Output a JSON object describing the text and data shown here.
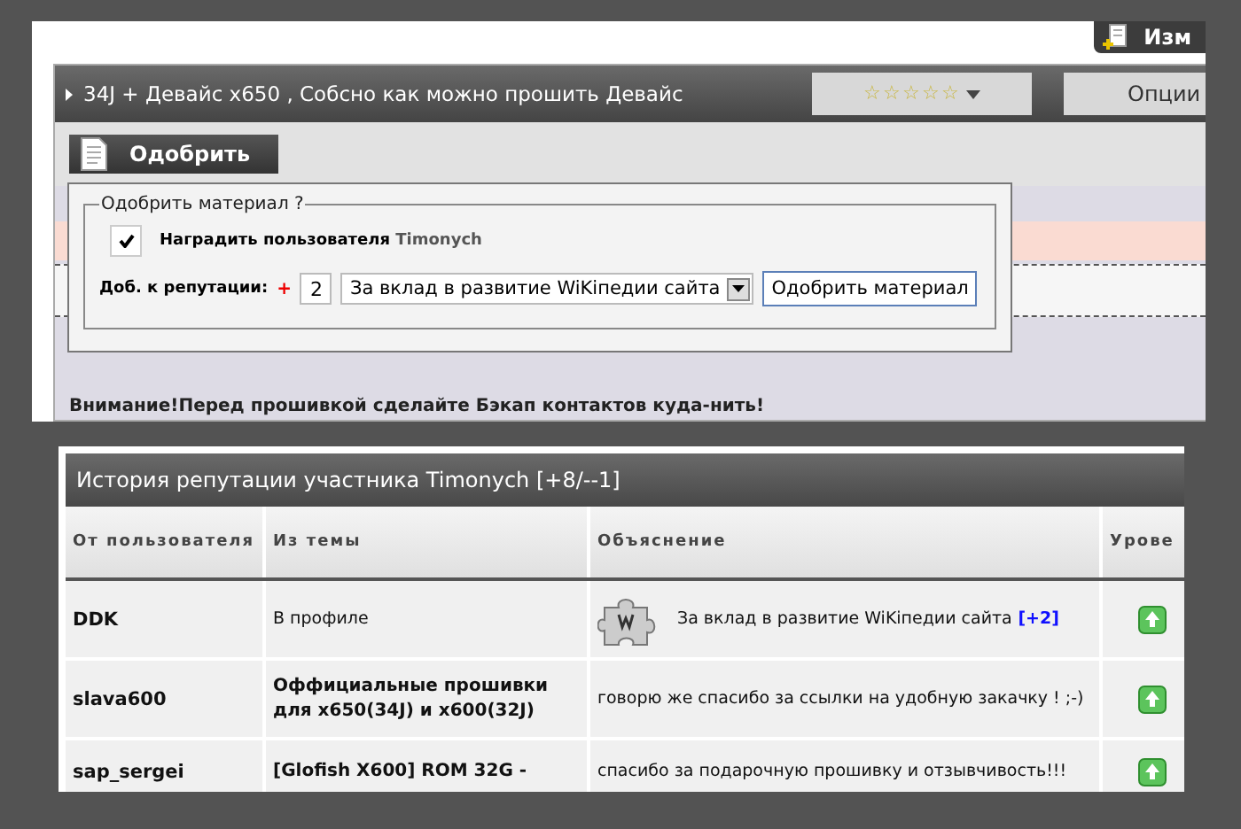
{
  "edit_tab": {
    "label": "Изм"
  },
  "topic": {
    "title": "34J + Девайс x650 , Собсно как можно прошить Девайс",
    "rating": {
      "stars": 0
    },
    "options_label": "Опции"
  },
  "approve_button": "Одобрить",
  "approve_dialog": {
    "legend": "Одобрить материал ?",
    "reward_checked": true,
    "reward_label": "Наградить пользователя",
    "reward_user": "Timonych",
    "rep_label": "Доб. к репутации:",
    "plus_sign": "+",
    "rep_value": "2",
    "reason": "За вклад в развитие WiKiпедии сайта",
    "submit": "Одобрить материал"
  },
  "notice": "Внимание!Перед прошивкой сделайте Бэкап контактов куда-нить!",
  "reputation": {
    "title": "История репутации участника Timonych [+8/--1]",
    "columns": [
      "От пользователя",
      "Из темы",
      "Объяснение",
      "Урове"
    ],
    "rows": [
      {
        "user": "DDK",
        "topic": "В профиле",
        "topic_bold": false,
        "kind": "wiki",
        "explanation": "За вклад в развитие WiKiпедии сайта",
        "points": "[+2]"
      },
      {
        "user": "slava600",
        "topic": "Оффициальные прошивки для x650(34J) и x600(32J)",
        "topic_bold": true,
        "kind": "plain",
        "explanation": "говорю же спасибо за ссылки на удобную закачку ! ;-)"
      },
      {
        "user": "sap_sergei",
        "topic": "[Glofish X600] ROM 32G -",
        "topic_bold": true,
        "kind": "plain",
        "explanation": "спасибо за подарочную прошивку и отзывчивость!!!"
      }
    ]
  }
}
